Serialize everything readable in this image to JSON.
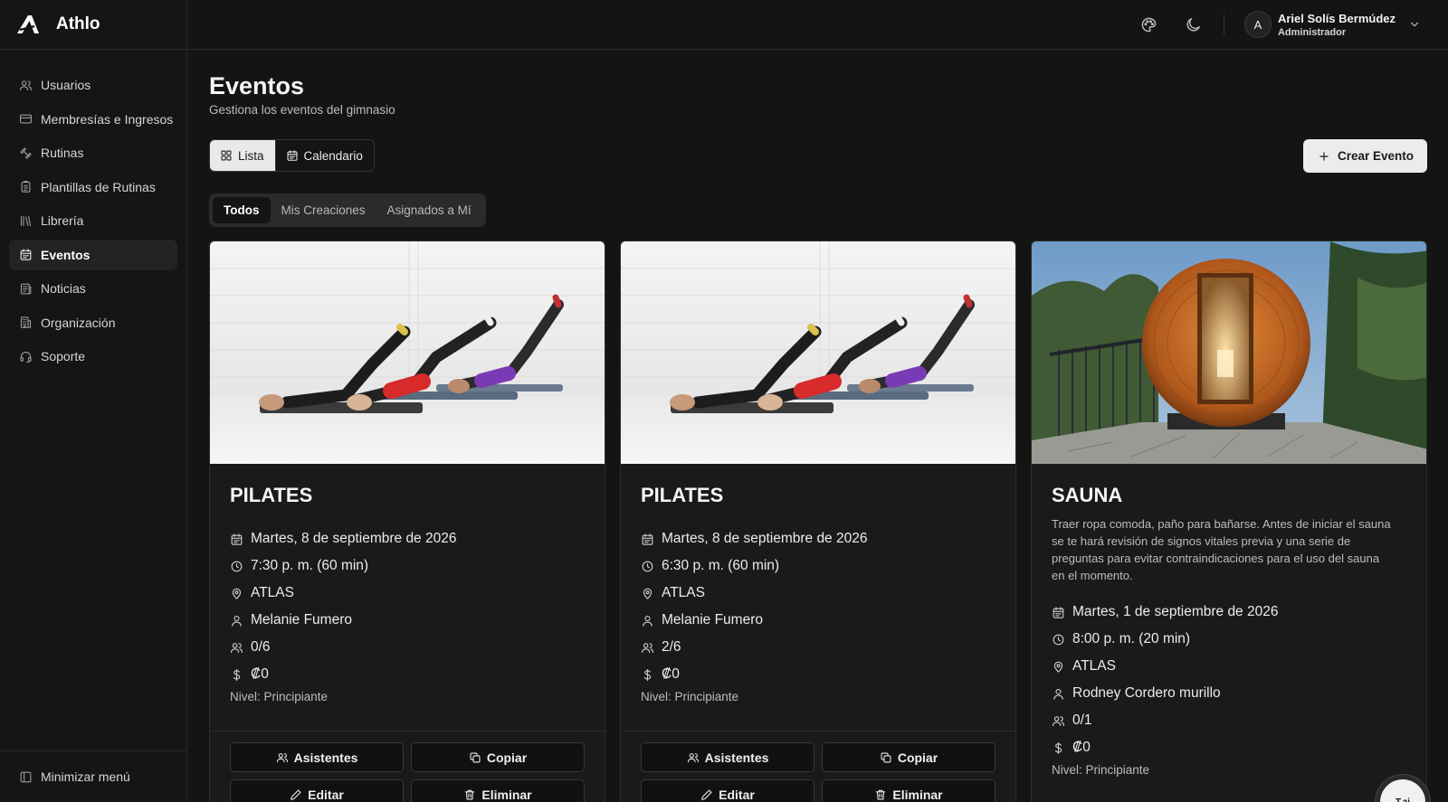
{
  "app": {
    "name": "Athlo"
  },
  "sidebar": {
    "items": [
      {
        "label": "Usuarios",
        "icon": "users-icon"
      },
      {
        "label": "Membresías e Ingresos",
        "icon": "credit-card-icon"
      },
      {
        "label": "Rutinas",
        "icon": "dumbbell-icon"
      },
      {
        "label": "Plantillas de Rutinas",
        "icon": "clipboard-icon"
      },
      {
        "label": "Librería",
        "icon": "library-icon"
      },
      {
        "label": "Eventos",
        "icon": "calendar-icon",
        "active": true
      },
      {
        "label": "Noticias",
        "icon": "newspaper-icon"
      },
      {
        "label": "Organización",
        "icon": "building-icon"
      },
      {
        "label": "Soporte",
        "icon": "headset-icon"
      }
    ],
    "minimize_label": "Minimizar menú"
  },
  "header": {
    "user": {
      "initial": "A",
      "name": "Ariel Solís Bermúdez",
      "role": "Administrador"
    }
  },
  "page": {
    "title": "Eventos",
    "subtitle": "Gestiona los eventos del gimnasio",
    "view_toggle": {
      "list": "Lista",
      "calendar": "Calendario",
      "active": "list"
    },
    "create_label": "Crear Evento",
    "filters": [
      "Todos",
      "Mis Creaciones",
      "Asignados a Mí"
    ],
    "active_filter": "Todos"
  },
  "events": [
    {
      "title": "PILATES",
      "description": "",
      "date": "Martes, 8 de septiembre de 2026",
      "time": "7:30 p. m. (60 min)",
      "location": "ATLAS",
      "instructor": "Melanie Fumero",
      "capacity": "0/6",
      "price": "₡0",
      "level": "Nivel: Principiante"
    },
    {
      "title": "PILATES",
      "description": "",
      "date": "Martes, 8 de septiembre de 2026",
      "time": "6:30 p. m. (60 min)",
      "location": "ATLAS",
      "instructor": "Melanie Fumero",
      "capacity": "2/6",
      "price": "₡0",
      "level": "Nivel: Principiante"
    },
    {
      "title": "SAUNA",
      "description": "Traer ropa comoda, paño para bañarse. Antes de iniciar el sauna se te hará revisión de signos vitales previa y una serie de preguntas para evitar contraindicaciones para el uso del sauna en el momento.",
      "date": "Martes, 1 de septiembre de 2026",
      "time": "8:00 p. m. (20 min)",
      "location": "ATLAS",
      "instructor": "Rodney Cordero murillo",
      "capacity": "0/1",
      "price": "₡0",
      "level": "Nivel: Principiante"
    }
  ],
  "card_actions": {
    "attendees": "Asistentes",
    "copy": "Copiar",
    "edit": "Editar",
    "delete": "Eliminar"
  },
  "assistant": {
    "label": "T.ai"
  }
}
